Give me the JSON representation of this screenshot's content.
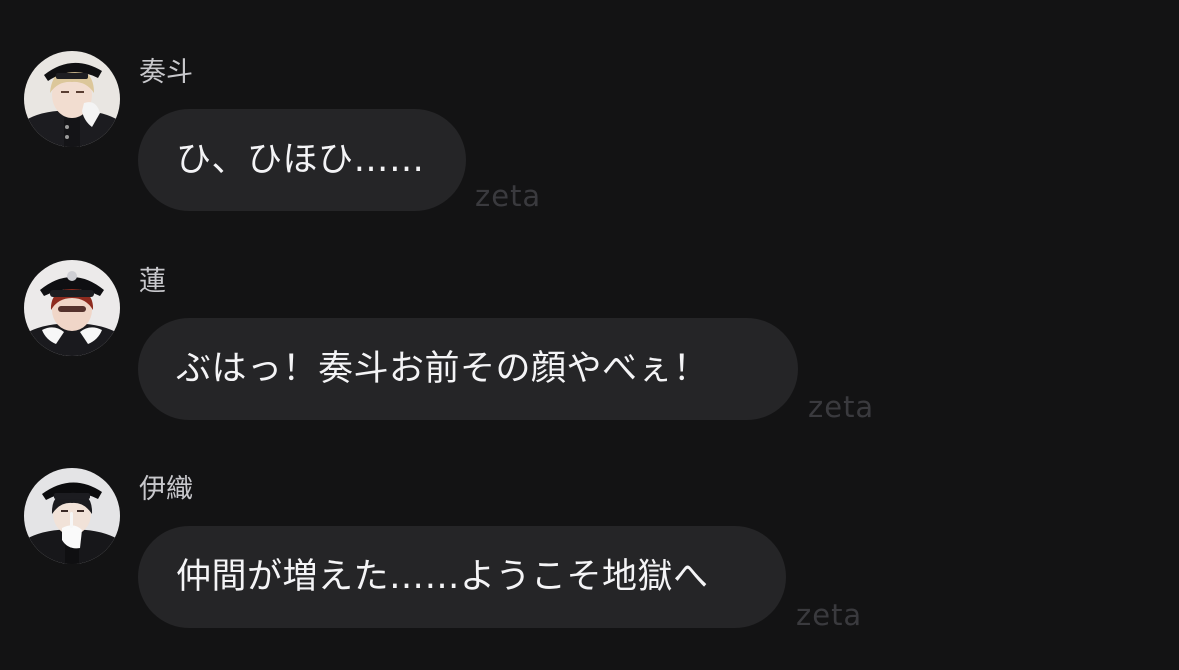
{
  "messages": [
    {
      "sender": "奏斗",
      "text": "ひ、ひほひ……",
      "watermark": "zeta",
      "avatar_icon": "blond-officer-avatar"
    },
    {
      "sender": "蓮",
      "text": "ぶはっ！奏斗お前その顔やべぇ！",
      "watermark": "zeta",
      "avatar_icon": "red-haired-officer-avatar"
    },
    {
      "sender": "伊織",
      "text": "仲間が増えた……ようこそ地獄へ",
      "watermark": "zeta",
      "avatar_icon": "dark-haired-officer-avatar"
    }
  ],
  "colors": {
    "background": "#131314",
    "bubble": "#252527",
    "text": "#f4f4f6",
    "sender": "#c8c8cc",
    "watermark": "#3a3a3e"
  }
}
